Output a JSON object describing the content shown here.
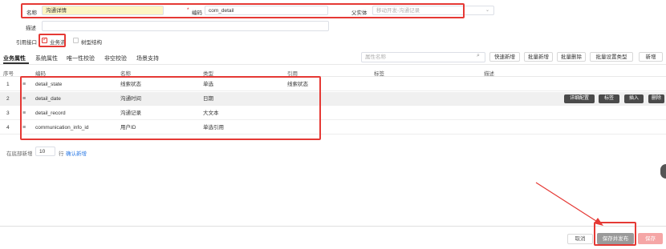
{
  "form": {
    "name_label": "名称",
    "name_value": "沟通详情",
    "code_required": "*",
    "code_label": "编码",
    "code_value": "com_detail",
    "parent_label": "父实体",
    "parent_placeholder": "移动开发-沟通记录",
    "desc_label": "描述",
    "ref_label": "引用接口",
    "ref_option1": "业务流",
    "ref_option2": "树型结构"
  },
  "tabs": [
    "业务属性",
    "系统属性",
    "唯一性校验",
    "非空校验",
    "场景支持"
  ],
  "toolbar": {
    "search_placeholder": "属性名称",
    "quick_add": "快速新增",
    "batch_add": "批量新增",
    "batch_delete": "批量删除",
    "batch_type": "批量设置类型",
    "add": "新增"
  },
  "table": {
    "headers": [
      "序号",
      "编码",
      "名称",
      "类型",
      "引用",
      "标签",
      "描述"
    ],
    "rows": [
      {
        "index": "1",
        "code": "detail_state",
        "name": "线索状态",
        "type": "单选",
        "ref": "线索状态"
      },
      {
        "index": "2",
        "code": "detail_date",
        "name": "沟通时间",
        "type": "日期",
        "ref": ""
      },
      {
        "index": "3",
        "code": "detail_record",
        "name": "沟通记录",
        "type": "大文本",
        "ref": ""
      },
      {
        "index": "4",
        "code": "communication_info_id",
        "name": "用户ID",
        "type": "单选引用",
        "ref": ""
      }
    ],
    "row_actions": [
      "详细配置",
      "标签",
      "插入",
      "删除"
    ]
  },
  "pager": {
    "prefix": "在底部新增",
    "count": "10",
    "suffix": "行",
    "confirm": "确认新增"
  },
  "footer": {
    "cancel": "取消",
    "save_publish": "保存并发布",
    "save": "保存"
  },
  "colors": {
    "annotation": "#e53935",
    "save_button": "#f5a6a6",
    "action_button": "#4a4a4a",
    "highlight_field": "#fdf6c3"
  }
}
